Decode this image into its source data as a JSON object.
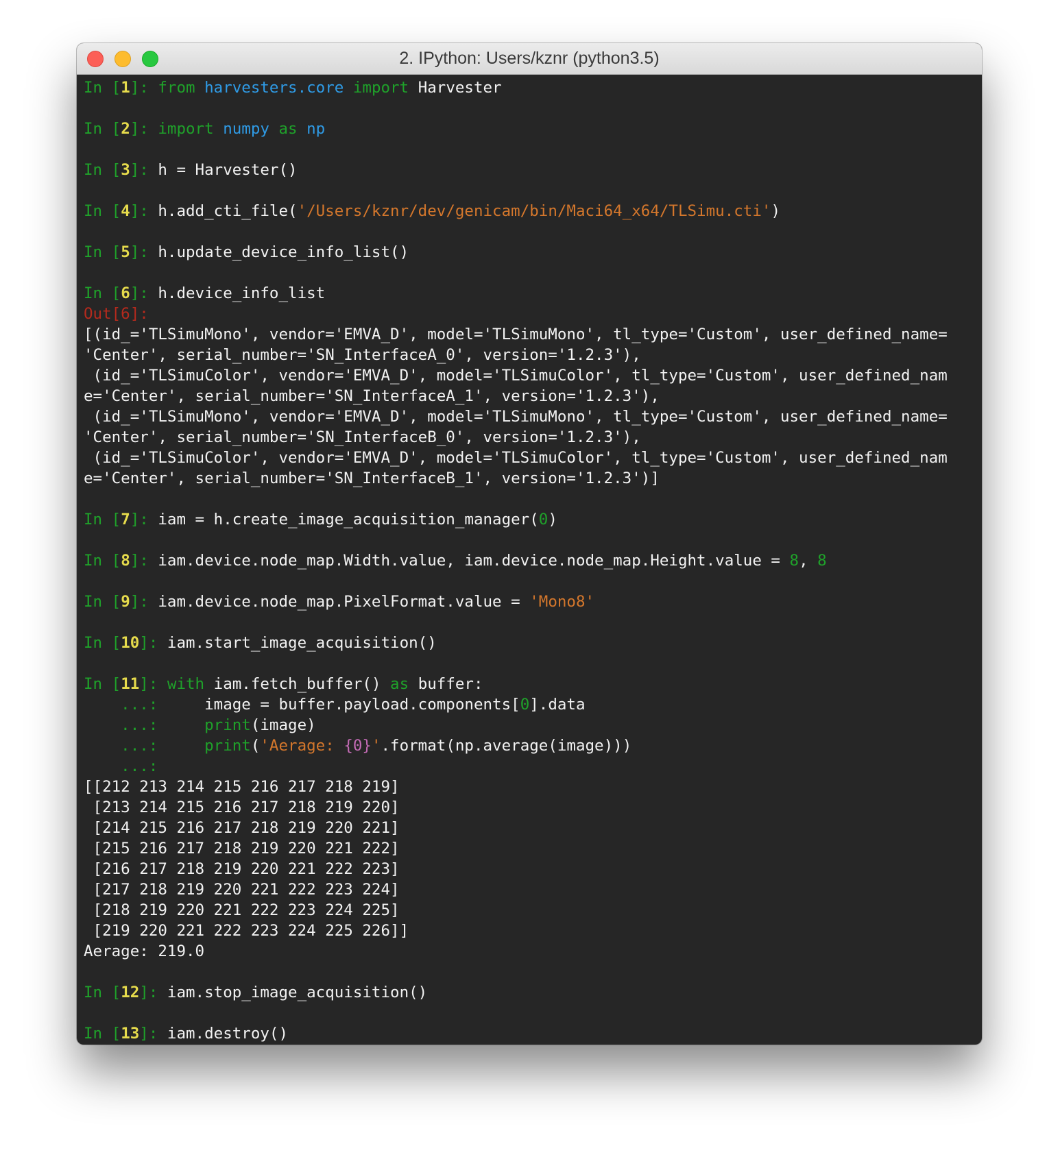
{
  "window": {
    "title": "2. IPython: Users/kznr (python3.5)"
  },
  "lines": [
    [
      [
        "g",
        "In ["
      ],
      [
        "y",
        "1"
      ],
      [
        "g",
        "]: "
      ],
      [
        "g",
        "from "
      ],
      [
        "b",
        "harvesters.core"
      ],
      [
        "g",
        " import "
      ],
      [
        "w",
        "Harvester"
      ]
    ],
    [],
    [
      [
        "g",
        "In ["
      ],
      [
        "y",
        "2"
      ],
      [
        "g",
        "]: "
      ],
      [
        "g",
        "import "
      ],
      [
        "b",
        "numpy"
      ],
      [
        "g",
        " as "
      ],
      [
        "b",
        "np"
      ]
    ],
    [],
    [
      [
        "g",
        "In ["
      ],
      [
        "y",
        "3"
      ],
      [
        "g",
        "]: "
      ],
      [
        "w",
        "h = Harvester()"
      ]
    ],
    [],
    [
      [
        "g",
        "In ["
      ],
      [
        "y",
        "4"
      ],
      [
        "g",
        "]: "
      ],
      [
        "w",
        "h.add_cti_file("
      ],
      [
        "s",
        "'/Users/kznr/dev/genicam/bin/Maci64_x64/TLSimu.cti'"
      ],
      [
        "w",
        ")"
      ]
    ],
    [],
    [
      [
        "g",
        "In ["
      ],
      [
        "y",
        "5"
      ],
      [
        "g",
        "]: "
      ],
      [
        "w",
        "h.update_device_info_list()"
      ]
    ],
    [],
    [
      [
        "g",
        "In ["
      ],
      [
        "y",
        "6"
      ],
      [
        "g",
        "]: "
      ],
      [
        "w",
        "h.device_info_list"
      ]
    ],
    [
      [
        "r",
        "Out[6]:"
      ]
    ],
    [
      [
        "w",
        "[(id_='TLSimuMono', vendor='EMVA_D', model='TLSimuMono', tl_type='Custom', user_defined_name="
      ]
    ],
    [
      [
        "w",
        "'Center', serial_number='SN_InterfaceA_0', version='1.2.3'),"
      ]
    ],
    [
      [
        "w",
        " (id_='TLSimuColor', vendor='EMVA_D', model='TLSimuColor', tl_type='Custom', user_defined_nam"
      ]
    ],
    [
      [
        "w",
        "e='Center', serial_number='SN_InterfaceA_1', version='1.2.3'),"
      ]
    ],
    [
      [
        "w",
        " (id_='TLSimuMono', vendor='EMVA_D', model='TLSimuMono', tl_type='Custom', user_defined_name="
      ]
    ],
    [
      [
        "w",
        "'Center', serial_number='SN_InterfaceB_0', version='1.2.3'),"
      ]
    ],
    [
      [
        "w",
        " (id_='TLSimuColor', vendor='EMVA_D', model='TLSimuColor', tl_type='Custom', user_defined_nam"
      ]
    ],
    [
      [
        "w",
        "e='Center', serial_number='SN_InterfaceB_1', version='1.2.3')]"
      ]
    ],
    [],
    [
      [
        "g",
        "In ["
      ],
      [
        "y",
        "7"
      ],
      [
        "g",
        "]: "
      ],
      [
        "w",
        "iam = h.create_image_acquisition_manager("
      ],
      [
        "n",
        "0"
      ],
      [
        "w",
        ")"
      ]
    ],
    [],
    [
      [
        "g",
        "In ["
      ],
      [
        "y",
        "8"
      ],
      [
        "g",
        "]: "
      ],
      [
        "w",
        "iam.device.node_map.Width.value, iam.device.node_map.Height.value = "
      ],
      [
        "n",
        "8"
      ],
      [
        "w",
        ", "
      ],
      [
        "n",
        "8"
      ]
    ],
    [],
    [
      [
        "g",
        "In ["
      ],
      [
        "y",
        "9"
      ],
      [
        "g",
        "]: "
      ],
      [
        "w",
        "iam.device.node_map.PixelFormat.value = "
      ],
      [
        "s",
        "'Mono8'"
      ]
    ],
    [],
    [
      [
        "g",
        "In ["
      ],
      [
        "y",
        "10"
      ],
      [
        "g",
        "]: "
      ],
      [
        "w",
        "iam.start_image_acquisition()"
      ]
    ],
    [],
    [
      [
        "g",
        "In ["
      ],
      [
        "y",
        "11"
      ],
      [
        "g",
        "]: "
      ],
      [
        "g",
        "with "
      ],
      [
        "w",
        "iam.fetch_buffer() "
      ],
      [
        "g",
        "as "
      ],
      [
        "w",
        "buffer:"
      ]
    ],
    [
      [
        "g",
        "    ...: "
      ],
      [
        "w",
        "    image = buffer.payload.components["
      ],
      [
        "n",
        "0"
      ],
      [
        "w",
        "].data"
      ]
    ],
    [
      [
        "g",
        "    ...: "
      ],
      [
        "w",
        "    "
      ],
      [
        "g",
        "print"
      ],
      [
        "w",
        "(image)"
      ]
    ],
    [
      [
        "g",
        "    ...: "
      ],
      [
        "w",
        "    "
      ],
      [
        "g",
        "print"
      ],
      [
        "w",
        "("
      ],
      [
        "s",
        "'Aerage: "
      ],
      [
        "m",
        "{0}"
      ],
      [
        "s",
        "'"
      ],
      [
        "w",
        ".format(np.average(image)))"
      ]
    ],
    [
      [
        "g",
        "    ...: "
      ]
    ],
    [
      [
        "w",
        "[[212 213 214 215 216 217 218 219]"
      ]
    ],
    [
      [
        "w",
        " [213 214 215 216 217 218 219 220]"
      ]
    ],
    [
      [
        "w",
        " [214 215 216 217 218 219 220 221]"
      ]
    ],
    [
      [
        "w",
        " [215 216 217 218 219 220 221 222]"
      ]
    ],
    [
      [
        "w",
        " [216 217 218 219 220 221 222 223]"
      ]
    ],
    [
      [
        "w",
        " [217 218 219 220 221 222 223 224]"
      ]
    ],
    [
      [
        "w",
        " [218 219 220 221 222 223 224 225]"
      ]
    ],
    [
      [
        "w",
        " [219 220 221 222 223 224 225 226]]"
      ]
    ],
    [
      [
        "w",
        "Aerage: 219.0"
      ]
    ],
    [],
    [
      [
        "g",
        "In ["
      ],
      [
        "y",
        "12"
      ],
      [
        "g",
        "]: "
      ],
      [
        "w",
        "iam.stop_image_acquisition()"
      ]
    ],
    [],
    [
      [
        "g",
        "In ["
      ],
      [
        "y",
        "13"
      ],
      [
        "g",
        "]: "
      ],
      [
        "w",
        "iam.destroy()"
      ]
    ]
  ]
}
